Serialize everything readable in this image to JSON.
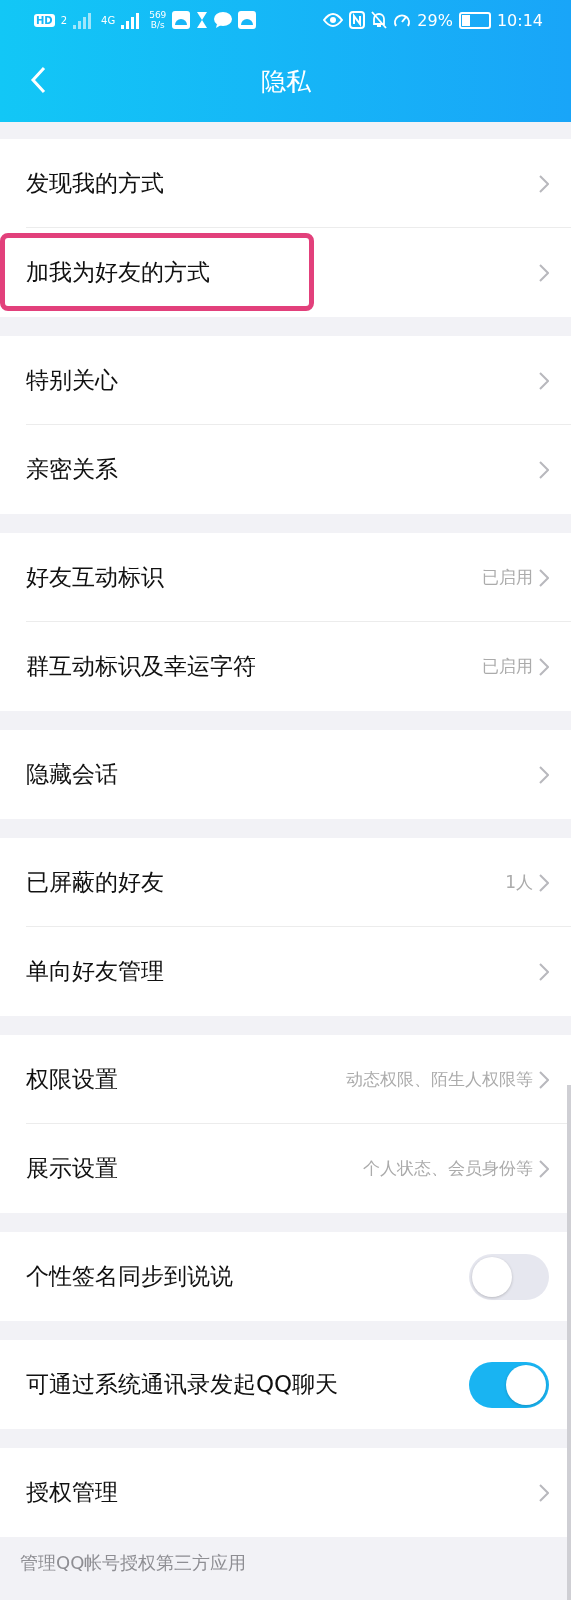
{
  "status_bar": {
    "hd": "HD",
    "sim": "2",
    "network": "4G",
    "speed": "569",
    "speed_unit": "B/s",
    "battery_text": "29%",
    "time": "10:14"
  },
  "header": {
    "title": "隐私"
  },
  "groups": [
    {
      "rows": [
        {
          "kind": "link",
          "label": "发现我的方式",
          "highlighted": false
        },
        {
          "kind": "link",
          "label": "加我为好友的方式",
          "highlighted": true
        }
      ]
    },
    {
      "rows": [
        {
          "kind": "link",
          "label": "特别关心",
          "highlighted": false
        },
        {
          "kind": "link",
          "label": "亲密关系",
          "highlighted": false
        }
      ]
    },
    {
      "rows": [
        {
          "kind": "link",
          "label": "好友互动标识",
          "value": "已启用",
          "highlighted": false
        },
        {
          "kind": "link",
          "label": "群互动标识及幸运字符",
          "value": "已启用",
          "highlighted": false
        }
      ]
    },
    {
      "rows": [
        {
          "kind": "link",
          "label": "隐藏会话",
          "highlighted": false
        }
      ]
    },
    {
      "rows": [
        {
          "kind": "link",
          "label": "已屏蔽的好友",
          "value": "1人",
          "highlighted": false
        },
        {
          "kind": "link",
          "label": "单向好友管理",
          "highlighted": false
        }
      ]
    },
    {
      "rows": [
        {
          "kind": "link",
          "label": "权限设置",
          "value": "动态权限、陌生人权限等",
          "highlighted": false
        },
        {
          "kind": "link",
          "label": "展示设置",
          "value": "个人状态、会员身份等",
          "highlighted": false
        }
      ]
    },
    {
      "rows": [
        {
          "kind": "toggle",
          "label": "个性签名同步到说说",
          "on": false,
          "highlighted": false
        }
      ]
    },
    {
      "rows": [
        {
          "kind": "toggle",
          "label": "可通过系统通讯录发起QQ聊天",
          "on": true,
          "highlighted": false
        }
      ]
    },
    {
      "rows": [
        {
          "kind": "link",
          "label": "授权管理",
          "highlighted": false
        }
      ]
    }
  ],
  "footer_note": "管理QQ帐号授权第三方应用"
}
